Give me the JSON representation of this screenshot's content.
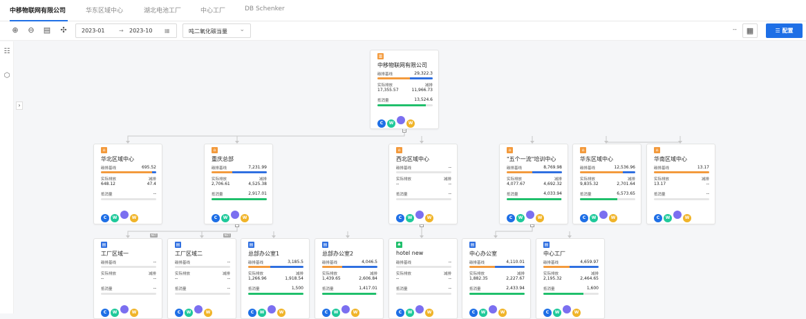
{
  "tabs": [
    {
      "label": "中移物联网有限公司",
      "active": true
    },
    {
      "label": "华东区域中心"
    },
    {
      "label": "湖北电池工厂"
    },
    {
      "label": "中心工厂"
    },
    {
      "label": "DB Schenker"
    }
  ],
  "toolbar": {
    "start": "2023-01",
    "arrow": "→",
    "end": "2023-10",
    "metric": "吨二氧化碳当量",
    "dash": "--",
    "config_label": "配置"
  },
  "labels": {
    "baseline": "碳排基线",
    "actual": "实际排放",
    "reduction": "减排",
    "offset": "抵消量"
  },
  "badge_letters": [
    "C",
    "W",
    "",
    "W"
  ],
  "tag_text": "NET",
  "colors": {
    "accent": "#1e6fe6",
    "orange": "#f39a3c",
    "green": "#1fbf6b",
    "c": "#1e6fe6",
    "w1": "#1fc99a",
    "p": "#7b6ff0",
    "w2": "#f0b429"
  },
  "nodes": [
    {
      "id": "root",
      "name": "中移物联网有限公司",
      "icon": "building-icon",
      "baseline": "29,322.3",
      "actual": "17,355.57",
      "reduction": "11,966.73",
      "offset": "13,524.6",
      "b_pct": 0.59,
      "r_pct": 0.41,
      "g_pct": 0.88
    },
    {
      "id": "n1",
      "name": "华北区域中心",
      "icon": "factory-icon",
      "baseline": "695.52",
      "actual": "648.12",
      "reduction": "47.4",
      "offset": "--",
      "b_pct": 0.93,
      "r_pct": 0.07,
      "g_pct": 0
    },
    {
      "id": "n2",
      "name": "重庆总部",
      "icon": "factory-icon",
      "baseline": "7,231.99",
      "actual": "2,706.61",
      "reduction": "4,525.38",
      "offset": "2,917.01",
      "b_pct": 0.37,
      "r_pct": 0.63,
      "g_pct": 1.0
    },
    {
      "id": "n3",
      "name": "西北区域中心",
      "icon": "factory-icon",
      "baseline": "--",
      "actual": "--",
      "reduction": "--",
      "offset": "--",
      "b_pct": 0,
      "r_pct": 0,
      "g_pct": 0
    },
    {
      "id": "n4",
      "name": "\"五个一流\"培训中心",
      "icon": "factory-icon",
      "baseline": "8,769.98",
      "actual": "4,077.67",
      "reduction": "4,692.32",
      "offset": "4,033.94",
      "b_pct": 0.46,
      "r_pct": 0.54,
      "g_pct": 0.99
    },
    {
      "id": "n5",
      "name": "华东区域中心",
      "icon": "factory-icon",
      "baseline": "12,536.96",
      "actual": "9,835.32",
      "reduction": "2,701.64",
      "offset": "6,573.65",
      "b_pct": 0.78,
      "r_pct": 0.22,
      "g_pct": 0.67
    },
    {
      "id": "n6",
      "name": "华南区域中心",
      "icon": "factory-icon",
      "baseline": "13.17",
      "actual": "13.17",
      "reduction": "--",
      "offset": "--",
      "b_pct": 1.0,
      "r_pct": 0,
      "g_pct": 0
    },
    {
      "id": "c1",
      "name": "工厂区域一",
      "icon": "office-icon",
      "baseline": "--",
      "actual": "--",
      "reduction": "--",
      "offset": "--",
      "b_pct": 0,
      "r_pct": 0,
      "g_pct": 0
    },
    {
      "id": "c2",
      "name": "工厂区域二",
      "icon": "office-icon",
      "baseline": "--",
      "actual": "--",
      "reduction": "--",
      "offset": "--",
      "b_pct": 0,
      "r_pct": 0,
      "g_pct": 0
    },
    {
      "id": "c3",
      "name": "总部办公室1",
      "icon": "office-icon",
      "baseline": "3,185.5",
      "actual": "1,266.96",
      "reduction": "1,918.54",
      "offset": "1,500",
      "b_pct": 0.4,
      "r_pct": 0.6,
      "g_pct": 1.0
    },
    {
      "id": "c4",
      "name": "总部办公室2",
      "icon": "office-icon",
      "baseline": "4,046.5",
      "actual": "1,439.65",
      "reduction": "2,606.84",
      "offset": "1,417.01",
      "b_pct": 0.36,
      "r_pct": 0.64,
      "g_pct": 0.98
    },
    {
      "id": "c5",
      "name": "hotel new",
      "icon": "leaf-icon",
      "baseline": "--",
      "actual": "--",
      "reduction": "--",
      "offset": "--",
      "b_pct": 0,
      "r_pct": 0,
      "g_pct": 0
    },
    {
      "id": "c6",
      "name": "中心办公室",
      "icon": "office-icon",
      "baseline": "4,110.01",
      "actual": "1,882.35",
      "reduction": "2,227.67",
      "offset": "2,433.94",
      "b_pct": 0.46,
      "r_pct": 0.54,
      "g_pct": 1.0
    },
    {
      "id": "c7",
      "name": "中心工厂",
      "icon": "office-icon",
      "baseline": "4,659.97",
      "actual": "2,195.32",
      "reduction": "2,464.65",
      "offset": "1,600",
      "b_pct": 0.47,
      "r_pct": 0.53,
      "g_pct": 0.73
    }
  ]
}
